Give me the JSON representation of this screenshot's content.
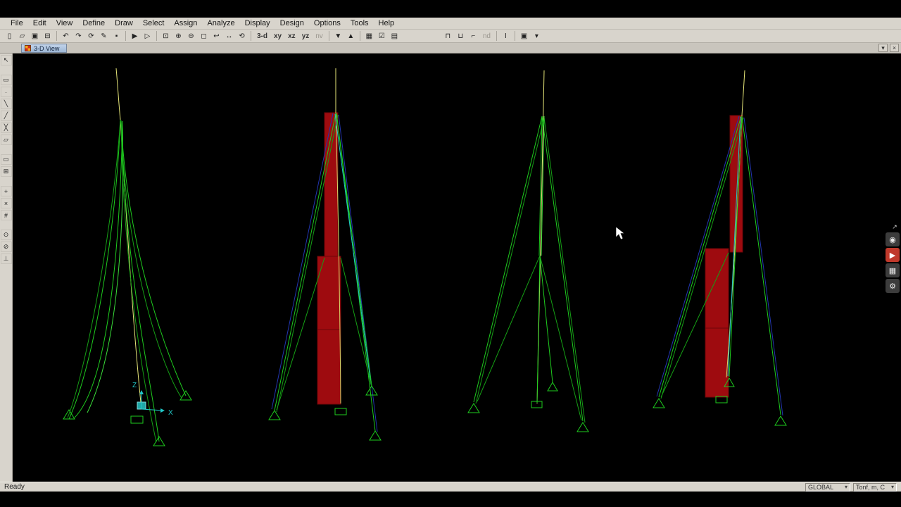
{
  "menu": {
    "items": [
      "File",
      "Edit",
      "View",
      "Define",
      "Draw",
      "Select",
      "Assign",
      "Analyze",
      "Display",
      "Design",
      "Options",
      "Tools",
      "Help"
    ]
  },
  "tab": {
    "label": "3-D View",
    "collapse_glyph": "▾",
    "close_glyph": "×"
  },
  "toolbar": {
    "icons": [
      {
        "name": "new-model",
        "glyph": "▯"
      },
      {
        "name": "open-file",
        "glyph": "▱"
      },
      {
        "name": "save-model",
        "glyph": "▣"
      },
      {
        "name": "print",
        "glyph": "⊟"
      },
      {
        "name": "undo",
        "glyph": "↶"
      },
      {
        "name": "redo",
        "glyph": "↷"
      },
      {
        "name": "refresh-window",
        "glyph": "⟳"
      },
      {
        "name": "draw-pencil",
        "glyph": "✎"
      },
      {
        "name": "lock-model",
        "glyph": "▪"
      },
      {
        "name": "run-analysis",
        "glyph": "▶"
      },
      {
        "name": "run-step",
        "glyph": "▷"
      },
      {
        "name": "zoom-window",
        "glyph": "⊡"
      },
      {
        "name": "zoom-in",
        "glyph": "⊕"
      },
      {
        "name": "zoom-out",
        "glyph": "⊖"
      },
      {
        "name": "zoom-full",
        "glyph": "◻"
      },
      {
        "name": "zoom-previous",
        "glyph": "↩"
      },
      {
        "name": "pan",
        "glyph": "↔"
      },
      {
        "name": "rotate-3d",
        "glyph": "⟲"
      }
    ],
    "views": [
      "3-d",
      "xy",
      "xz",
      "yz",
      "nv"
    ],
    "icons2": [
      {
        "name": "move-down-plane",
        "glyph": "▼"
      },
      {
        "name": "move-up-plane",
        "glyph": "▲"
      },
      {
        "name": "grid-options",
        "glyph": "▦"
      },
      {
        "name": "show-selected",
        "glyph": "☑"
      },
      {
        "name": "object-options",
        "glyph": "▤"
      }
    ],
    "icons3": [
      {
        "name": "frame-section",
        "glyph": "⊓"
      },
      {
        "name": "frame-release",
        "glyph": "⊔"
      },
      {
        "name": "joint-constraint",
        "glyph": "⌐"
      },
      {
        "name": "nd-view",
        "glyph": "nd"
      },
      {
        "name": "section-cut",
        "glyph": "I"
      },
      {
        "name": "display-options",
        "glyph": "▣"
      },
      {
        "name": "dropdown",
        "glyph": "▾"
      }
    ]
  },
  "left_toolbar": {
    "icons": [
      {
        "name": "select-pointer",
        "glyph": "↖"
      },
      {
        "name": "reshape-object",
        "glyph": "▭"
      },
      {
        "name": "draw-joint",
        "glyph": "∙"
      },
      {
        "name": "draw-frame",
        "glyph": "╲"
      },
      {
        "name": "quick-draw-frame",
        "glyph": "╱"
      },
      {
        "name": "quick-draw-brace",
        "glyph": "╳"
      },
      {
        "name": "draw-poly-area",
        "glyph": "▱"
      },
      {
        "name": "draw-rect-area",
        "glyph": "▭"
      },
      {
        "name": "quick-draw-area",
        "glyph": "⊞"
      },
      {
        "name": "select-all",
        "glyph": "+"
      },
      {
        "name": "clear-selection",
        "glyph": "×"
      },
      {
        "name": "intersecting-select",
        "glyph": "#"
      },
      {
        "name": "snap-joints",
        "glyph": "⊙"
      },
      {
        "name": "snap-midpoints",
        "glyph": "⊘"
      },
      {
        "name": "snap-perpendicular",
        "glyph": "⊥"
      }
    ]
  },
  "float_panel": {
    "icons": [
      {
        "name": "pin-panel",
        "glyph": "↗"
      },
      {
        "name": "camera-snapshot",
        "glyph": "◉"
      },
      {
        "name": "record-video",
        "glyph": "▶"
      },
      {
        "name": "image-capture",
        "glyph": "▦"
      },
      {
        "name": "settings",
        "glyph": "⚙"
      }
    ]
  },
  "viewport": {
    "axis_x": "X",
    "axis_z": "Z"
  },
  "status": {
    "ready": "Ready",
    "coord_system": "GLOBAL",
    "units": "Tonf, m, C",
    "dropdown_glyph": "▾"
  },
  "colors": {
    "model_green": "#1ecb1e",
    "model_yellow": "#e8e87a",
    "model_red": "#9e0b0f",
    "model_blue": "#2236b0",
    "model_cyan": "#21c8c8"
  }
}
